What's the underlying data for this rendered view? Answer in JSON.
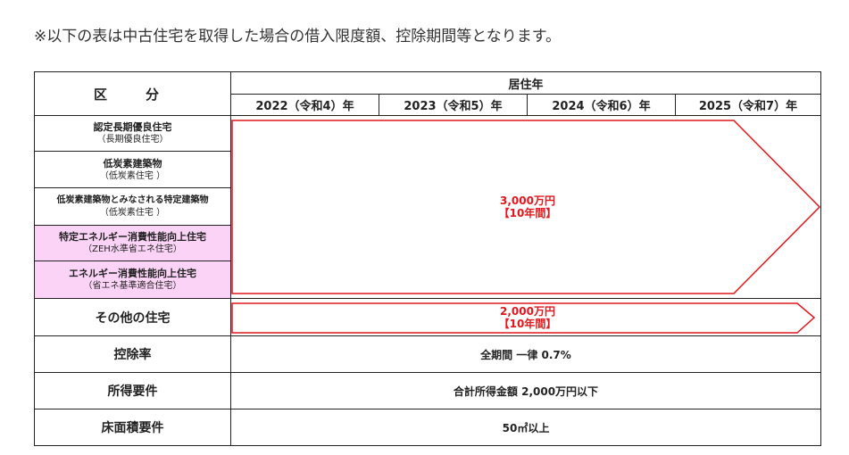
{
  "note": "※以下の表は中古住宅を取得した場合の借入限度額、控除期間等となります。",
  "table": {
    "kubun_label": "区　分",
    "residence_year_label": "居住年",
    "years": [
      "2022（令和4）年",
      "2023（令和5）年",
      "2024（令和6）年",
      "2025（令和7）年"
    ],
    "categories": [
      {
        "main": "認定長期優良住宅",
        "sub": "（長期優良住宅）"
      },
      {
        "main": "低炭素建築物",
        "sub": "（低炭素住宅 ）"
      },
      {
        "main": "低炭素建築物とみなされる特定建築物",
        "sub": "（低炭素住宅 ）"
      },
      {
        "main": "特定エネルギー消費性能向上住宅",
        "sub": "（ZEH水準省エネ住宅）"
      },
      {
        "main": "エネルギー消費性能向上住宅",
        "sub": "（省エネ基準適合住宅）"
      }
    ],
    "group1_amount": "3,000万円",
    "group1_period": "【10年間】",
    "other_label": "その他の住宅",
    "other_amount": "2,000万円",
    "other_period": "【10年間】",
    "rate_label": "控除率",
    "rate_value": "全期間 一律 0.7%",
    "income_label": "所得要件",
    "income_value": "合計所得金額 2,000万円以下",
    "floor_label": "床面積要件",
    "floor_value": "50㎡以上",
    "arrow_color": "#e2161b",
    "pink_color": "#fbd3f6"
  }
}
